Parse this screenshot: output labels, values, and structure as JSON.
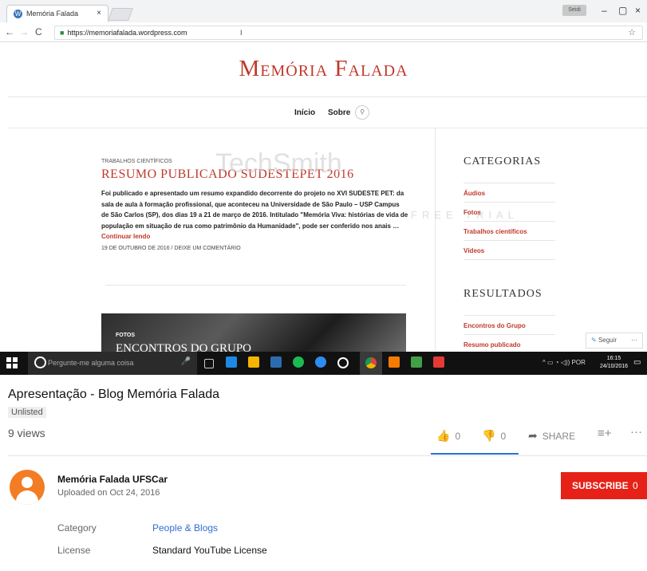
{
  "browser": {
    "tab_title": "Memória Falada",
    "tab_close": "×",
    "profile_label": "Seidi",
    "window_controls": [
      "–",
      "▢",
      "×"
    ],
    "url": "https://memoriafalada.wordpress.com",
    "nav_icons": [
      "back-icon",
      "forward-icon",
      "reload-icon"
    ],
    "star": "☆"
  },
  "site": {
    "title": "Memória Falada",
    "menu": [
      "Início",
      "Sobre"
    ],
    "post": {
      "category": "TRABALHOS CIENTÍFICOS",
      "title": "RESUMO PUBLICADO SUDESTEPET 2016",
      "excerpt": "Foi publicado e apresentado um resumo expandido decorrente do projeto no XVI SUDESTE PET: da sala de aula à formação profissional, que aconteceu na Universidade de São Paulo – USP Campus de São Carlos (SP), dos dias 19 a 21 de março de 2016. Intitulado \"Memória Viva: histórias de vida de população em situação de rua como patrimônio da Humanidade\", pode ser conferido nos anais …",
      "more": "Continuar lendo",
      "meta": "19 DE OUTUBRO DE 2016 / DEIXE UM COMENTÁRIO"
    },
    "featured": {
      "category": "FOTOS",
      "title": "ENCONTROS DO GRUPO"
    },
    "sidebar": {
      "categories_heading": "CATEGORIAS",
      "categories": [
        "Áudios",
        "Fotos",
        "Trabalhos científicos",
        "Vídeos"
      ],
      "results_heading": "RESULTADOS",
      "results": [
        "Encontros do Grupo",
        "Resumo publicado"
      ]
    },
    "follow_label": "Seguir",
    "follow_more": "···"
  },
  "watermark": {
    "main": "TechSmith",
    "sub": "FREE TRIAL"
  },
  "taskbar": {
    "search_placeholder": "Pergunte-me alguma coisa",
    "language": "POR",
    "time": "16:15",
    "date": "24/10/2016",
    "app_colors": [
      "#1e88e5",
      "#f4b400",
      "#2b6cb0",
      "#1db954",
      "#2d8cf0",
      "#ffffff",
      "#db4437",
      "#f57c00",
      "#43a047",
      "#e53935"
    ]
  },
  "video": {
    "title": "Apresentação - Blog Memória Falada",
    "privacy": "Unlisted",
    "views": "9 views",
    "likes": "0",
    "dislikes": "0",
    "share": "SHARE",
    "channel": "Memória Falada UFSCar",
    "uploaded": "Uploaded on Oct 24, 2016",
    "subscribe": "SUBSCRIBE",
    "subscribers": "0",
    "category_label": "Category",
    "category_value": "People & Blogs",
    "license_label": "License",
    "license_value": "Standard YouTube License"
  },
  "colors": {
    "accent_red": "#c0392b",
    "subscribe_red": "#e62117",
    "link_blue": "#2f6fd6"
  }
}
